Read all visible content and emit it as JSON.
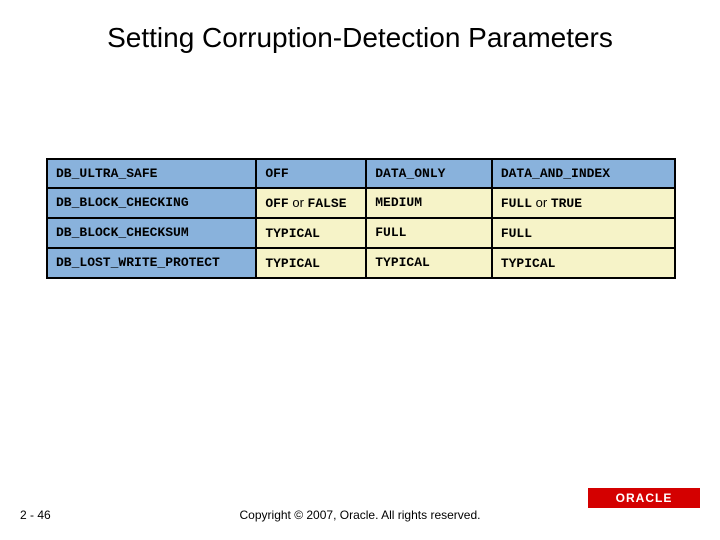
{
  "title": "Setting Corruption-Detection Parameters",
  "table": {
    "header": {
      "param": "DB_ULTRA_SAFE",
      "colA": "OFF",
      "colB": "DATA_ONLY",
      "colC": "DATA_AND_INDEX"
    },
    "rows": [
      {
        "param": "DB_BLOCK_CHECKING",
        "a_pre": "OFF",
        "a_mid": " or ",
        "a_post": "FALSE",
        "b": "MEDIUM",
        "c_pre": "FULL",
        "c_mid": " or ",
        "c_post": "TRUE"
      },
      {
        "param": "DB_BLOCK_CHECKSUM",
        "a_pre": "TYPICAL",
        "a_mid": "",
        "a_post": "",
        "b": "FULL",
        "c_pre": "FULL",
        "c_mid": "",
        "c_post": ""
      },
      {
        "param": "DB_LOST_WRITE_PROTECT",
        "a_pre": "TYPICAL",
        "a_mid": "",
        "a_post": "",
        "b": "TYPICAL",
        "c_pre": "TYPICAL",
        "c_mid": "",
        "c_post": ""
      }
    ]
  },
  "footer": {
    "page": "2 - 46",
    "copyright": "Copyright © 2007, Oracle. All rights reserved.",
    "logo_text": "ORACLE"
  },
  "colors": {
    "header_bg": "#89b2dc",
    "body_bg": "#f6f3c8",
    "logo_bg": "#d40000"
  }
}
